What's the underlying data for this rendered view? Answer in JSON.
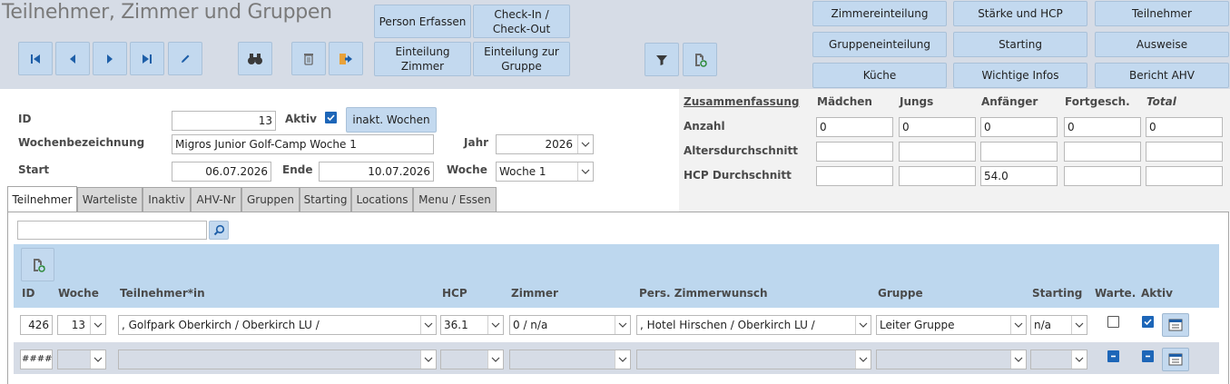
{
  "header": {
    "title": "Teilnehmer, Zimmer und Gruppen",
    "buttons": {
      "person_erfassen": "Person Erfassen",
      "checkin": "Check-In /\nCheck-Out",
      "einteilung_zimmer": "Einteilung\nZimmer",
      "einteilung_gruppe": "Einteilung zur\nGruppe",
      "zimmereinteilung": "Zimmereinteilung",
      "staerke_hcp": "Stärke und HCP",
      "teilnehmer": "Teilnehmer",
      "gruppeneinteilung": "Gruppeneinteilung",
      "starting": "Starting",
      "ausweise": "Ausweise",
      "kueche": "Küche",
      "wichtige_infos": "Wichtige Infos",
      "bericht_ahv": "Bericht  AHV"
    }
  },
  "form": {
    "id_label": "ID",
    "id_value": "13",
    "aktiv_label": "Aktiv",
    "aktiv_checked": true,
    "inaktiv_button": "inakt. Wochen",
    "wochenbez_label": "Wochenbezeichnung",
    "wochenbez_value": "Migros Junior Golf-Camp Woche 1",
    "jahr_label": "Jahr",
    "jahr_value": "2026",
    "start_label": "Start",
    "start_value": "06.07.2026",
    "ende_label": "Ende",
    "ende_value": "10.07.2026",
    "woche_label": "Woche",
    "woche_value": "Woche 1"
  },
  "summary": {
    "title": "Zusammenfassung",
    "columns": [
      "Mädchen",
      "Jungs",
      "Anfänger",
      "Fortgesch.",
      "Total"
    ],
    "rows": [
      {
        "label": "Anzahl",
        "values": [
          "0",
          "0",
          "0",
          "0",
          "0"
        ]
      },
      {
        "label": "Altersdurchschnitt",
        "values": [
          "",
          "",
          "",
          "",
          ""
        ]
      },
      {
        "label": "HCP Durchschnitt",
        "values": [
          "",
          "",
          "54.0",
          "",
          ""
        ]
      }
    ]
  },
  "tabs": [
    "Teilnehmer",
    "Warteliste",
    "Inaktiv",
    "AHV-Nr",
    "Gruppen",
    "Starting",
    "Locations",
    "Menu / Essen"
  ],
  "search": {
    "value": ""
  },
  "grid": {
    "headers": {
      "id": "ID",
      "woche": "Woche",
      "teilnehmer": "Teilnehmer*in",
      "hcp": "HCP",
      "zimmer": "Zimmer",
      "zimmerwunsch": "Pers. Zimmerwunsch",
      "gruppe": "Gruppe",
      "starting": "Starting",
      "warte": "Warte.",
      "aktiv": "Aktiv"
    },
    "row": {
      "id": "426",
      "woche": "13",
      "teilnehmer": ", Golfpark Oberkirch / Oberkirch LU /",
      "hcp": "36.1",
      "zimmer": "0 / n/a",
      "zimmerwunsch": ", Hotel Hirschen / Oberkirch LU /",
      "gruppe": "Leiter Gruppe",
      "starting": "n/a",
      "warte": false,
      "aktiv": true
    },
    "new_row": {
      "id": "#####"
    }
  },
  "colors": {
    "accent": "#c3d9ef",
    "header_bg": "#d6dce6",
    "grid_header_bg": "#bdd7ee",
    "checkbox": "#1d66b8"
  }
}
